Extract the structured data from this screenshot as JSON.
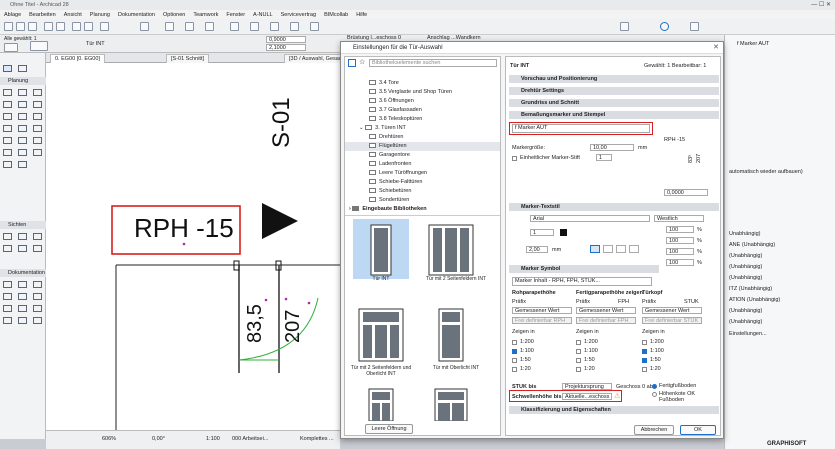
{
  "app": {
    "title": "Ohne Titel - Archicad 28"
  },
  "menu": [
    "Ablage",
    "Bearbeiten",
    "Ansicht",
    "Planung",
    "Dokumentation",
    "Optionen",
    "Teamwork",
    "Fenster",
    "A-NULL",
    "Servicevertrag",
    "BIMcollab",
    "Hilfe"
  ],
  "infobar": {
    "all_selected": "Alle gewählt: 1",
    "element_label": "Tür INT",
    "val1": "0,9000",
    "val2": "2,1000",
    "field1": "Brüstung l...eschoss 0",
    "field2": "Anschlag ...Wandkern"
  },
  "palette": {
    "planung": "Planung",
    "sichten": "Sichten",
    "dokumentation": "Dokumentation"
  },
  "view_tabs": [
    "0. EG00 [0. EG00]",
    "[S-01 Schnitt]",
    "[3D / Auswahl, Gesamt]"
  ],
  "canvas": {
    "marker_text": "RPH -15",
    "section_label": "S-01",
    "dim1": "83,5",
    "dim2": "207"
  },
  "statusbar": {
    "zoom": "606%",
    "angle": "0,00°",
    "scale": "1:100",
    "layer": "000 Arbeitsei...",
    "complete": "Komplettes ..."
  },
  "dialog": {
    "title": "Einstellungen für die Tür-Auswahl",
    "search_placeholder": "Bibliothekselemente suchen",
    "tree": [
      "3.4 Tore",
      "3.5 Verglaste und Shop Türen",
      "3.6 Öffnungen",
      "3.7 Glasfassaden",
      "3.8 Teleskoptüren",
      "3. Türen INT",
      "Drehtüren",
      "Flügeltüren",
      "Garagentore",
      "Ladenfronten",
      "Leere Türöffnungen",
      "Schiebe-Falttüren",
      "Schiebetüren",
      "Sondertüren",
      "Eingebaute Bibliotheken"
    ],
    "thumbs": [
      "Tür INT",
      "Tür mit 2 Seitenfeldern INT",
      "Tür mit 2 Seitenfeldern und Oberlicht INT",
      "Tür mit Oberlicht INT"
    ],
    "clear_button": "Leere Öffnung",
    "element_name": "Tür INT",
    "selected_count": "Gewählt: 1 Bearbeitbar: 1",
    "sections": [
      "Vorschau und Positionierung",
      "Drehtür Settings",
      "Grundriss und Schnitt",
      "Bemaßungsmarker und Stempel",
      "Marker-Textstil",
      "Marker Symbol",
      "Klassifizierung und Eigenschaften"
    ],
    "marker_select": "f Marker AUT",
    "marker_size_label": "Markergröße:",
    "marker_size_value": "10,00",
    "marker_size_unit": "mm",
    "pen_label": "Einheitlicher Marker-Stift",
    "pen_value": "1",
    "preview_text": "RPH -15",
    "preview_v1": "83⁵",
    "preview_v2": "207",
    "preview_coord": "0,0000",
    "font": "Arial",
    "script": "Westlich",
    "text_pen": "1",
    "text_size": "2,00",
    "text_size_unit": "mm",
    "pct": [
      "100",
      "100",
      "100",
      "100"
    ],
    "pct_unit": "%",
    "marker_content": "Marker Inhalt - RPH, FPH, STUK...",
    "col_headers": [
      "Rohparapethöhe",
      "Fertigparapethöhe zeigen",
      "Türkopf"
    ],
    "col_sub": [
      "Präfix",
      "Präfix",
      "FPH",
      "Präfix",
      "STUK"
    ],
    "col_values": [
      "Gemessener Wert",
      "Gemessener Wert",
      "Gemessener Wert"
    ],
    "col_free": [
      "Frei definierbar RPH",
      "Frei definierbar FPH",
      "Frei definierbar STUK"
    ],
    "zeigen_in": "Zeigen in",
    "scales": [
      "1:200",
      "1:100",
      "1:50",
      "1:20"
    ],
    "stuk_label": "STUK bis",
    "stuk_value": "Projektursprung",
    "stuk_suffix": "Geschoss 0 ab",
    "radio1": "Fertigfußboden",
    "radio2": "Höhenkote OK Fußboden",
    "schwellen_label": "Schwellenhöhe bis",
    "schwellen_value": "Aktuelle...eschoss",
    "cancel": "Abbrechen",
    "ok": "OK"
  },
  "rpanel": {
    "title": "f Marker AUT",
    "lines": [
      "automatisch wieder aufbauen)",
      "Unabhängig)",
      "ANE (Unabhängig)",
      "(Unabhängig)",
      "(Unabhängig)",
      "(Unabhängig)",
      "ITZ (Unabhängig)",
      "ATION (Unabhängig)",
      "(Unabhängig)",
      "(Unabhängig)"
    ],
    "einstellungen": "Einstellungen...",
    "graphisoft": "GRAPHISOFT"
  },
  "colors": {
    "accent": "#1e6fc8",
    "highlight": "#d92020",
    "thumb_selected": "#bcd8f3"
  }
}
